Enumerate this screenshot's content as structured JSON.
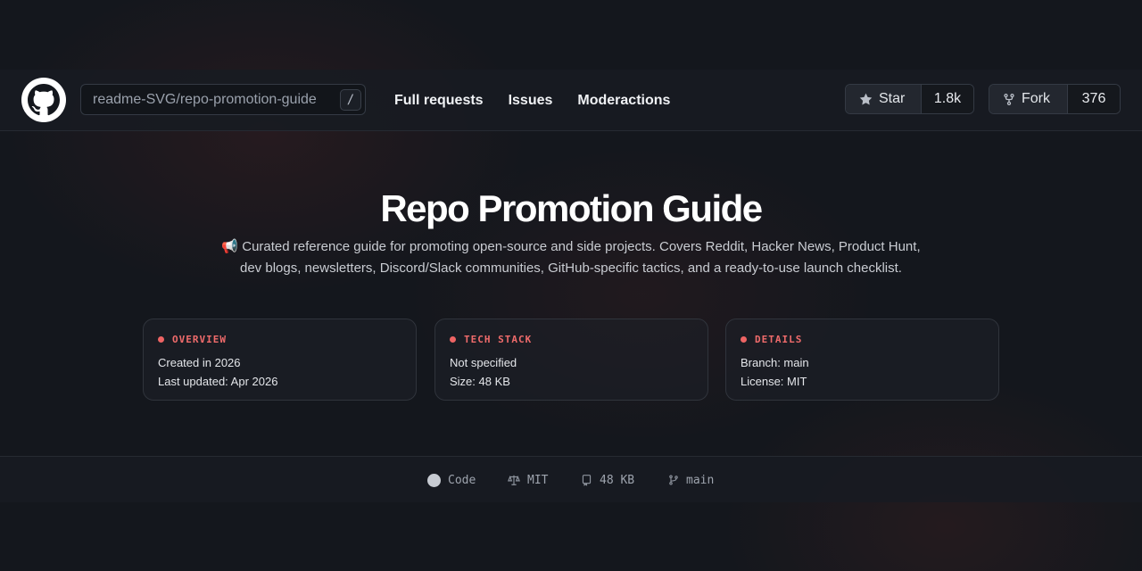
{
  "header": {
    "search": {
      "value": "readme-SVG/repo-promotion-guide",
      "shortcut": "/"
    },
    "nav": [
      "Full requests",
      "Issues",
      "Moderactions"
    ],
    "star": {
      "label": "Star",
      "count": "1.8k",
      "icon": "star-icon"
    },
    "fork": {
      "label": "Fork",
      "count": "376",
      "icon": "fork-icon"
    }
  },
  "hero": {
    "title": "Repo Promotion Guide",
    "description_icon": "📢",
    "description": "Curated reference guide for promoting open-source and side projects. Covers Reddit, Hacker News, Product Hunt, dev blogs, newsletters, Discord/Slack communities, GitHub-specific tactics, and a ready-to-use launch checklist."
  },
  "cards": [
    {
      "heading": "OVERVIEW",
      "lines": [
        "Created in 2026",
        "Last updated: Apr 2026"
      ]
    },
    {
      "heading": "TECH STACK",
      "lines": [
        "Not specified",
        "Size: 48 KB"
      ]
    },
    {
      "heading": "DETAILS",
      "lines": [
        "Branch: main",
        "License: MIT"
      ]
    }
  ],
  "footer": {
    "language": "Code",
    "license": "MIT",
    "size": "48 KB",
    "branch": "main"
  },
  "colors": {
    "accent": "#ee6464",
    "background": "#14171d"
  }
}
